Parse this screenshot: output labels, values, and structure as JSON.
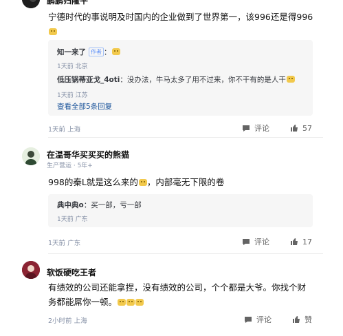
{
  "comment1": {
    "author": "鹏鹏归隆平",
    "content_line1": "宁德时代的事说明及时国内的企业做到了世界第一，该996还是得996",
    "replies": [
      {
        "author": "知一来了",
        "tag": "作者",
        "text": "",
        "time": "1天前",
        "location": "北京"
      },
      {
        "author": "低压锅蒂亚戈_4oti",
        "text": "没办法，牛马太多了用不过来，你不干有的是人干",
        "time": "1天前",
        "location": "江苏"
      }
    ],
    "more_replies": "查看全部5条回复",
    "time": "1天前",
    "location": "上海",
    "comment_label": "评论",
    "like_count": "57"
  },
  "comment2": {
    "author": "在温哥华买买买的熊猫",
    "badge": "生产营运 · 5年+",
    "content": "998的秦L就是这么来的",
    "content_after": "，内部毫无下限的卷",
    "reply": {
      "author": "典中典o",
      "text": "买一部，亏一部",
      "time": "1天前",
      "location": "广东"
    },
    "time": "1天前",
    "location": "广东",
    "comment_label": "评论",
    "like_count": "17"
  },
  "comment3": {
    "author": "软饭硬吃王者",
    "content_line1": "有绩效的公司还能拿捏，没有绩效的公司，个个都是大爷。你找个财",
    "content_line2": "务都能屌你一顿。",
    "time": "2小时前",
    "location": "上海",
    "comment_label": "评论",
    "like_label": "赞"
  },
  "colors": {
    "link": "#175199",
    "meta": "#8590a6",
    "reply_bg": "#f6f6f6"
  }
}
